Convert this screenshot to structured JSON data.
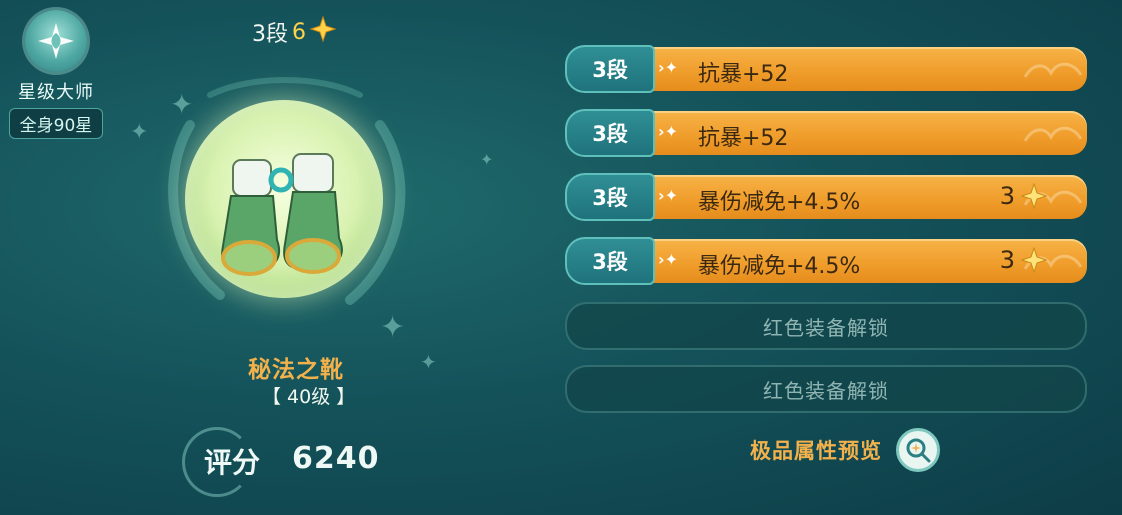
{
  "master": {
    "title": "星级大师",
    "subtitle": "全身90星",
    "icon": "star-emblem-icon"
  },
  "item": {
    "tier_label": "3段",
    "stars": "6",
    "name": "秘法之靴",
    "level": "【 40级 】",
    "score_label": "评分",
    "score_value": "6240",
    "image": "green-boots-icon"
  },
  "attributes": [
    {
      "tier": "3段",
      "text": "抗暴+52",
      "stars": ""
    },
    {
      "tier": "3段",
      "text": "抗暴+52",
      "stars": ""
    },
    {
      "tier": "3段",
      "text": "暴伤减免+4.5%",
      "stars": "3"
    },
    {
      "tier": "3段",
      "text": "暴伤减免+4.5%",
      "stars": "3"
    }
  ],
  "locked_slots": [
    {
      "text": "红色装备解锁"
    },
    {
      "text": "红色装备解锁"
    }
  ],
  "preview": {
    "label": "极品属性预览",
    "icon": "magnifier-sparkle-icon"
  },
  "colors": {
    "accent_gold": "#f2b14b",
    "bar_orange": "#ef9c2a",
    "teal": "#1f737c",
    "star_yellow": "#ffd24a"
  }
}
